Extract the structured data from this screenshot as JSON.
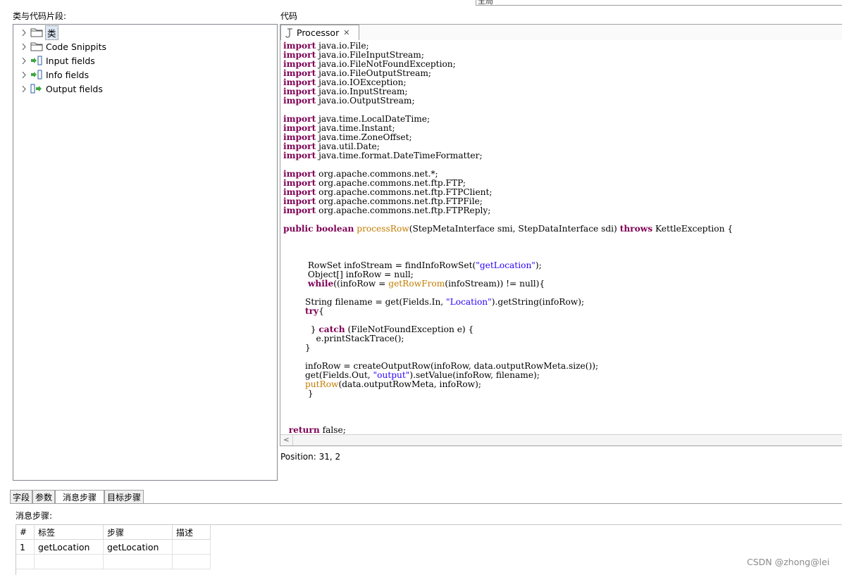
{
  "top_field": {
    "value": "全局"
  },
  "left_panel": {
    "title": "类与代码片段:",
    "items": [
      {
        "label": "类",
        "icon": "folder-icon",
        "selected": true
      },
      {
        "label": "Code Snippits",
        "icon": "folder-icon"
      },
      {
        "label": "Input fields",
        "icon": "input-fields-icon"
      },
      {
        "label": "Info fields",
        "icon": "info-fields-icon"
      },
      {
        "label": "Output fields",
        "icon": "output-fields-icon"
      }
    ]
  },
  "code_panel": {
    "title": "代码",
    "tab_label": "Processor",
    "tab_icon": "java-file-icon",
    "close_icon": "close-icon",
    "position_text": "Position: 31, 2",
    "lines": [
      [
        {
          "t": "import",
          "c": "kw"
        },
        {
          "t": " java.io.File;"
        }
      ],
      [
        {
          "t": "import",
          "c": "kw"
        },
        {
          "t": " java.io.FileInputStream;"
        }
      ],
      [
        {
          "t": "import",
          "c": "kw"
        },
        {
          "t": " java.io.FileNotFoundException;"
        }
      ],
      [
        {
          "t": "import",
          "c": "kw"
        },
        {
          "t": " java.io.FileOutputStream;"
        }
      ],
      [
        {
          "t": "import",
          "c": "kw"
        },
        {
          "t": " java.io.IOException;"
        }
      ],
      [
        {
          "t": "import",
          "c": "kw"
        },
        {
          "t": " java.io.InputStream;"
        }
      ],
      [
        {
          "t": "import",
          "c": "kw"
        },
        {
          "t": " java.io.OutputStream;"
        }
      ],
      [],
      [
        {
          "t": "import",
          "c": "kw"
        },
        {
          "t": " java.time.LocalDateTime;"
        }
      ],
      [
        {
          "t": "import",
          "c": "kw"
        },
        {
          "t": " java.time.Instant;"
        }
      ],
      [
        {
          "t": "import",
          "c": "kw"
        },
        {
          "t": " java.time.ZoneOffset;"
        }
      ],
      [
        {
          "t": "import",
          "c": "kw"
        },
        {
          "t": " java.util.Date;"
        }
      ],
      [
        {
          "t": "import",
          "c": "kw"
        },
        {
          "t": " java.time.format.DateTimeFormatter;"
        }
      ],
      [],
      [
        {
          "t": "import",
          "c": "kw"
        },
        {
          "t": " org.apache.commons.net.*;"
        }
      ],
      [
        {
          "t": "import",
          "c": "kw"
        },
        {
          "t": " org.apache.commons.net.ftp.FTP;"
        }
      ],
      [
        {
          "t": "import",
          "c": "kw"
        },
        {
          "t": " org.apache.commons.net.ftp.FTPClient;"
        }
      ],
      [
        {
          "t": "import",
          "c": "kw"
        },
        {
          "t": " org.apache.commons.net.ftp.FTPFile;"
        }
      ],
      [
        {
          "t": "import",
          "c": "kw"
        },
        {
          "t": " org.apache.commons.net.ftp.FTPReply;"
        }
      ],
      [],
      [
        {
          "t": "public",
          "c": "kw"
        },
        {
          "t": " "
        },
        {
          "t": "boolean",
          "c": "kw"
        },
        {
          "t": " "
        },
        {
          "t": "processRow",
          "c": "fn"
        },
        {
          "t": "(StepMetaInterface smi, StepDataInterface sdi) "
        },
        {
          "t": "throws",
          "c": "kw"
        },
        {
          "t": " KettleException {"
        }
      ],
      [],
      [],
      [],
      [
        {
          "t": "         RowSet infoStream = findInfoRowSet("
        },
        {
          "t": "\"getLocation\"",
          "c": "st"
        },
        {
          "t": ");"
        }
      ],
      [
        {
          "t": "         Object[] infoRow = null;"
        }
      ],
      [
        {
          "t": "         "
        },
        {
          "t": "while",
          "c": "kw"
        },
        {
          "t": "((infoRow = "
        },
        {
          "t": "getRowFrom",
          "c": "fn"
        },
        {
          "t": "(infoStream)) != null){"
        }
      ],
      [],
      [
        {
          "t": "        String filename = get(Fields.In, "
        },
        {
          "t": "\"Location\"",
          "c": "st"
        },
        {
          "t": ").getString(infoRow);"
        }
      ],
      [
        {
          "t": "        "
        },
        {
          "t": "try",
          "c": "kw"
        },
        {
          "t": "{"
        }
      ],
      [],
      [
        {
          "t": "          } "
        },
        {
          "t": "catch",
          "c": "kw"
        },
        {
          "t": " (FileNotFoundException e) {"
        }
      ],
      [
        {
          "t": "            e.printStackTrace();"
        }
      ],
      [
        {
          "t": "        }"
        }
      ],
      [],
      [
        {
          "t": "        infoRow = createOutputRow(infoRow, data.outputRowMeta.size());"
        }
      ],
      [
        {
          "t": "        get(Fields.Out, "
        },
        {
          "t": "\"output\"",
          "c": "st"
        },
        {
          "t": ").setValue(infoRow, filename);"
        }
      ],
      [
        {
          "t": "        "
        },
        {
          "t": "putRow",
          "c": "fn"
        },
        {
          "t": "(data.outputRowMeta, infoRow);"
        }
      ],
      [
        {
          "t": "         }"
        }
      ],
      [],
      [],
      [],
      [
        {
          "t": "  "
        },
        {
          "t": "return",
          "c": "kw"
        },
        {
          "t": " false;"
        }
      ]
    ]
  },
  "bottom_tabs": [
    {
      "label": "字段"
    },
    {
      "label": "参数"
    },
    {
      "label": "消息步骤",
      "active": true
    },
    {
      "label": "目标步骤"
    }
  ],
  "message_steps": {
    "label": "消息步骤:",
    "columns": [
      "#",
      "标签",
      "步骤",
      "描述"
    ],
    "rows": [
      [
        "1",
        "getLocation",
        "getLocation",
        ""
      ]
    ]
  },
  "watermark": "CSDN @zhong@lei"
}
